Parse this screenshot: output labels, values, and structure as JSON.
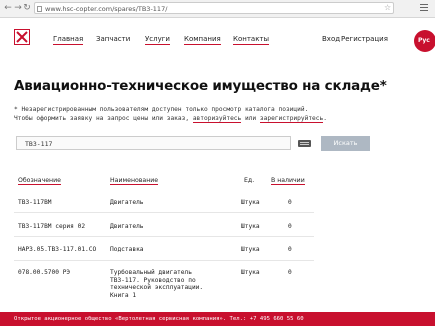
{
  "browser": {
    "url": "www.hsc-copter.com/spares/ТВ3-117/"
  },
  "header": {
    "nav": [
      "Главная",
      "Запчасти",
      "Услуги",
      "Компания",
      "Контакты"
    ],
    "login": "Вход",
    "register": "Регистрация",
    "lang_badge": "Рус"
  },
  "page": {
    "title": "Авиационно-техническое имущество на складе*",
    "note_line1": "* Незарегистрированным пользователям доступен только просмотр каталога позиций.",
    "note_line2_pre": "Чтобы оформить заявку на запрос цены или заказ, ",
    "note_link_auth": "авторизуйтесь",
    "note_or": " или ",
    "note_link_reg": "зарегистрируйтесь",
    "note_end": "."
  },
  "search": {
    "value": "ТВ3-117",
    "button": "Искать"
  },
  "table": {
    "headers": {
      "code": "Обозначение",
      "name": "Наименование",
      "unit": "Ед.",
      "stock": "В наличии"
    },
    "rows": [
      {
        "code": "ТВ3-117ВМ",
        "name": [
          "Двигатель"
        ],
        "unit": "Штука",
        "stock": "0"
      },
      {
        "code": "ТВ3-117ВМ серия 02",
        "name": [
          "Двигатель"
        ],
        "unit": "Штука",
        "stock": "0"
      },
      {
        "code": "НАР3.05.ТВ3-117.01.СО",
        "name": [
          "Подставка"
        ],
        "unit": "Штука",
        "stock": "0"
      },
      {
        "code": "078.00.5700 РЭ",
        "name": [
          "Турбовальный двигатель",
          "ТВ3-117. Руководство по",
          "технической эксплуатации.",
          "Книга 1"
        ],
        "unit": "Штука",
        "stock": "0"
      }
    ]
  },
  "footer": {
    "text": "Открытое акционерное общество «Вертолетная сервисная компания». Тел.: +7 495 660 55 60"
  },
  "colors": {
    "accent": "#c8102e",
    "button": "#aeb8c3"
  }
}
